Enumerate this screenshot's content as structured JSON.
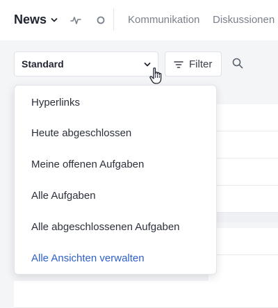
{
  "header": {
    "app_title": "News",
    "nav_links": [
      "Kommunikation",
      "Diskussionen"
    ]
  },
  "toolbar": {
    "view_selected": "Standard",
    "filter_label": "Filter"
  },
  "dropdown": {
    "items": [
      "Hyperlinks",
      "Heute abgeschlossen",
      "Meine offenen Aufgaben",
      "Alle Aufgaben",
      "Alle abgeschlossenen Aufgaben"
    ],
    "manage_link": "Alle Ansichten verwalten"
  },
  "colors": {
    "link": "#2d5fc9",
    "text": "#1f2430",
    "muted": "#7a808c",
    "background": "#f4f5f7"
  }
}
